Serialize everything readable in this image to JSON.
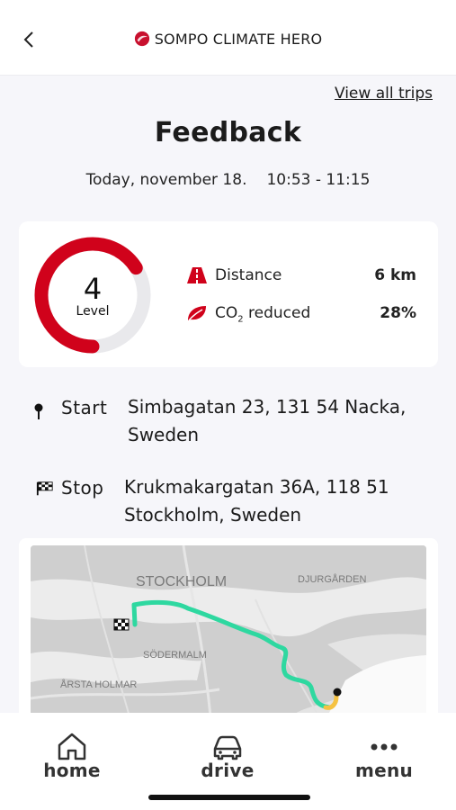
{
  "header": {
    "brand": "SOMPO CLIMATE HERO",
    "back_icon": "chevron-left-icon"
  },
  "links": {
    "view_all": "View all trips"
  },
  "page": {
    "title": "Feedback",
    "date": "Today, november 18.",
    "time_range": "10:53 - 11:15"
  },
  "summary": {
    "level_value": "4",
    "level_label": "Level",
    "level_fraction": 0.66,
    "accent": "#d0021b",
    "distance_label": "Distance",
    "distance_value": "6 km",
    "co2_label_prefix": "CO",
    "co2_label_sub": "2",
    "co2_label_suffix": " reduced",
    "co2_value": "28%"
  },
  "trip": {
    "start_label": "Start",
    "start_address": "Simbagatan 23, 131 54 Nacka, Sweden",
    "stop_label": "Stop",
    "stop_address": "Krukmakargatan 36A, 118 51 Stockholm, Sweden"
  },
  "map": {
    "labels": {
      "stockholm": "STOCKHOLM",
      "djurgarden": "DJURGÅRDEN",
      "sodermalm": "SÖDERMALM",
      "arsta": "ÅRSTA HOLMAR"
    },
    "route_color": "#2ed8a0"
  },
  "tabbar": {
    "home": "home",
    "drive": "drive",
    "menu": "menu"
  }
}
